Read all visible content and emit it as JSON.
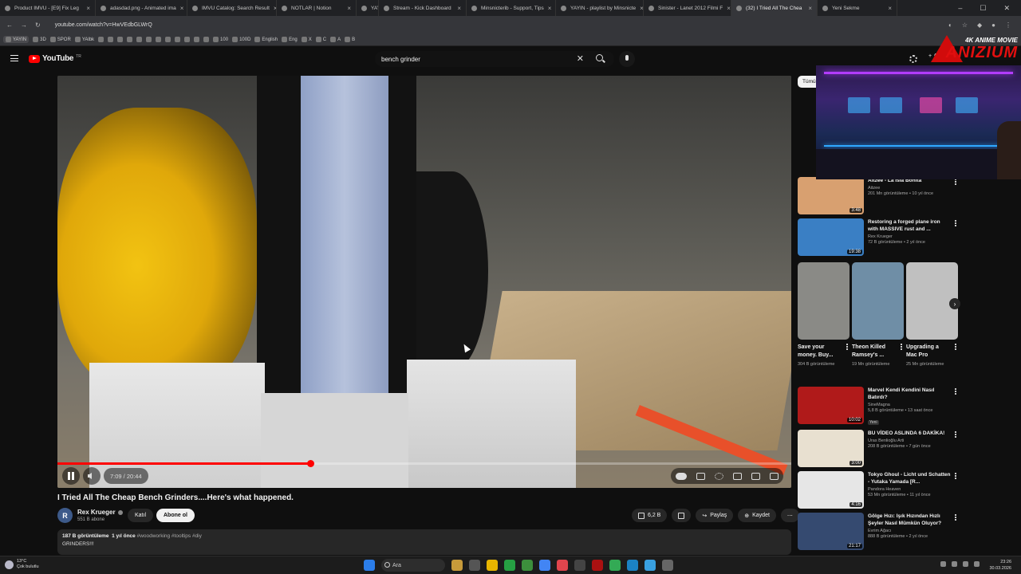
{
  "tabs": [
    {
      "label": "Product IMVU - [E9] Fix Leg",
      "active": false
    },
    {
      "label": "adasdad.png - Animated ima",
      "active": false
    },
    {
      "label": "IMVU Catalog: Search Result",
      "active": false
    },
    {
      "label": "NOTLAR | Notion",
      "active": false
    },
    {
      "label": "YAYIN",
      "active": false
    },
    {
      "label": "Stream - Kick Dashboard",
      "active": false
    },
    {
      "label": "Minsnicterib - Support, Tips",
      "active": false
    },
    {
      "label": "YAYIN - playlist by Minsnicte",
      "active": false
    },
    {
      "label": "Sinister - Lanet 2012 Filmi F",
      "active": false
    },
    {
      "label": "(32) I Tried All The Chea",
      "active": true
    },
    {
      "label": "Yeni Sekme",
      "active": false
    }
  ],
  "address": {
    "url": "youtube.com/watch?v=HwVEdbGLWrQ"
  },
  "bookmarks": [
    "YAYIN",
    "3D",
    "SPOR",
    "YAlbk",
    "100",
    "100D",
    "English",
    "Eng",
    "X",
    "C",
    "A",
    "B"
  ],
  "header": {
    "logo_text": "YouTube",
    "logo_suffix": "TR",
    "search_value": "bench grinder",
    "create_label": "Oluştur"
  },
  "brand": {
    "tag": "4K ANIME MOVIE",
    "name": "ANIZIUM"
  },
  "player": {
    "current_time": "7:09",
    "duration": "20:44",
    "time_display": "7:09 / 20:44",
    "progress_fraction": 0.345
  },
  "video": {
    "title": "I Tried All The Cheap Bench Grinders....Here's what happened.",
    "channel": "Rex Krueger",
    "channel_initial": "R",
    "subscribers": "551 B abone",
    "join_label": "Katıl",
    "subscribe_label": "Abone ol",
    "likes": "6,2 B",
    "share_label": "Paylaş",
    "save_label": "Kaydet",
    "views": "187 B görüntüleme",
    "age": "1 yıl önce",
    "tags": "#woodworking #tooltips #diy",
    "desc_line": "GRINDERS!!!"
  },
  "sidebar": {
    "chip": "Tümü",
    "recs_top": [
      {
        "title": "Aitzee - La Isla Bonita",
        "channel": "Aitzee",
        "views": "201 Mn görüntüleme • 10 yıl önce",
        "duration": "3:48",
        "color": "#d8a070"
      },
      {
        "title": "Restoring a forged plane iron with MASSIVE rust and ...",
        "channel": "Rex Krueger",
        "views": "72 B görüntüleme • 2 yıl önce",
        "duration": "19:38",
        "color": "#3a7fc4"
      }
    ],
    "shorts": [
      {
        "title": "Save your money. Buy...",
        "views": "304 B görüntüleme",
        "color": "#8a8a86"
      },
      {
        "title": "Theon Killed Ramsey's ...",
        "views": "19 Mn görüntüleme",
        "color": "#6f8ea6"
      },
      {
        "title": "Upgrading a Mac Pro",
        "views": "25 Mn görüntüleme",
        "color": "#c0c0c0"
      }
    ],
    "recs_bottom": [
      {
        "title": "Marvel Kendi Kendini Nasıl Batırdı?",
        "channel": "SineMagna",
        "views": "5,8 B görüntüleme • 13 saat önce",
        "badge": "Yeni",
        "duration": "10:02",
        "color": "#b01a1a"
      },
      {
        "title": "BU VİDEO ASLINDA 6 DAKİKA!",
        "channel": "Uras Benlioğlu Arti",
        "views": "208 B görüntüleme • 7 gün önce",
        "badge": "",
        "duration": "3:00",
        "color": "#e8e0d0"
      },
      {
        "title": "Tokyo Ghoul - Licht und Schatten - Yutaka Yamada [R...",
        "channel": "Pandora Heaven",
        "views": "53 Mn görüntüleme • 11 yıl önce",
        "badge": "",
        "duration": "4:16",
        "color": "#e6e6e6"
      },
      {
        "title": "Gölge Hızı: Işık Hızından Hızlı Şeyler Nasıl Mümkün Oluyor?",
        "channel": "Evrim Ağacı",
        "views": "888 B görüntüleme • 2 yıl önce",
        "badge": "",
        "duration": "21:17",
        "color": "#354a70"
      }
    ]
  },
  "taskbar": {
    "temp": "13°C",
    "weather": "Çok bulutlu",
    "search_label": "Ara",
    "time": "23:26",
    "date": "30.03.2026"
  },
  "colors": {
    "accent": "#ff0000",
    "background": "#0f0f0f",
    "chip": "#272727"
  }
}
